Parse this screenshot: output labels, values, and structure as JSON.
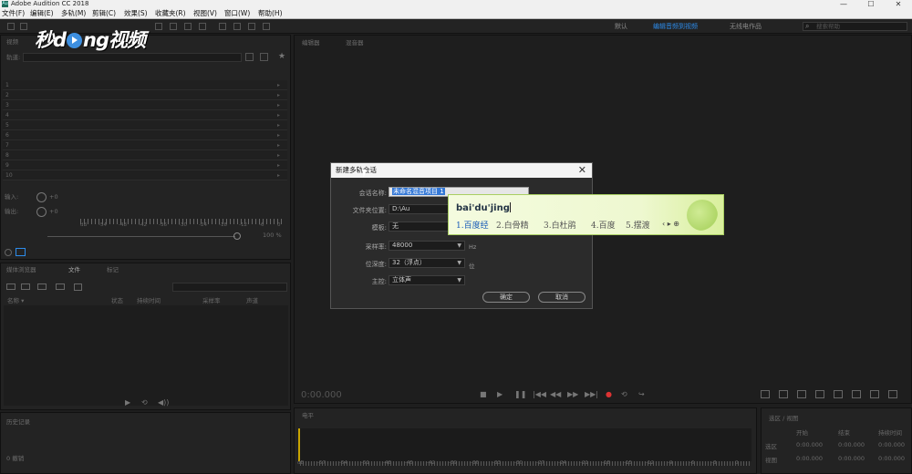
{
  "window": {
    "title": "Adobe Audition CC 2018",
    "icon_text": "Au",
    "controls": [
      "—",
      "☐",
      "✕"
    ]
  },
  "menu": [
    "文件(F)",
    "编辑(E)",
    "多轨(M)",
    "剪辑(C)",
    "效果(S)",
    "收藏夹(R)",
    "视图(V)",
    "窗口(W)",
    "帮助(H)"
  ],
  "workspaces": [
    "默认",
    "编辑音频到视频",
    "无线电作品"
  ],
  "active_workspace": "编辑音频到视频",
  "search": {
    "placeholder": "搜索帮助",
    "icon": "search-icon"
  },
  "logo": {
    "part1": "秒",
    "part2": "d",
    "part3": "ng视频"
  },
  "left_panel": {
    "tab": "视频",
    "track_label": "轨道:",
    "track_numbers": [
      "1",
      "2",
      "3",
      "4",
      "5",
      "6",
      "7",
      "8",
      "9",
      "10"
    ],
    "input_label": "输入:",
    "output_label": "输出:",
    "gain_in": "+0",
    "gain_out": "+0",
    "meter_scale": [
      "dB",
      "-54",
      "-48",
      "-42",
      "-36",
      "-30",
      "-24",
      "-18",
      "-12",
      "-6",
      "0"
    ],
    "zoom_percent": "100 %"
  },
  "files_panel": {
    "tabs": [
      "媒体浏览器",
      "文件",
      "标记"
    ],
    "active_tab": "文件",
    "columns": [
      "名称 ▾",
      "状态",
      "持续时间",
      "采样率",
      "声道"
    ]
  },
  "history_panel": {
    "tab": "历史记录",
    "footer": "0 撤销"
  },
  "editor": {
    "tabs": [
      "编辑器",
      "混音器"
    ],
    "time": "0:00.000"
  },
  "dialog": {
    "title": "新建多轨会话",
    "close": "✕",
    "fields": {
      "session_name_label": "会话名称:",
      "session_name_value": "未命名混音项目 1",
      "folder_label": "文件夹位置:",
      "folder_value": "D:\\Au",
      "template_label": "模板:",
      "template_value": "无",
      "sample_rate_label": "采样率:",
      "sample_rate_value": "48000",
      "sample_rate_unit": "Hz",
      "bit_depth_label": "位深度:",
      "bit_depth_value": "32（浮点）",
      "bit_depth_unit": "位",
      "master_label": "主控:",
      "master_value": "立体声"
    },
    "ok": "确定",
    "cancel": "取消"
  },
  "ime": {
    "pinyin": "bai'du'jing",
    "candidates": [
      "1.百度经",
      "2.白骨精",
      "3.白杜鹃",
      "4.百度",
      "5.摆渡"
    ],
    "nav": "‹ ▸ ⊕"
  },
  "bottom_meter": {
    "tab": "电平",
    "scale": [
      "dB",
      "-57",
      "-54",
      "-51",
      "-48",
      "-45",
      "-42",
      "-39",
      "-36",
      "-33",
      "-30",
      "-27",
      "-24",
      "-21",
      "-18",
      "-15",
      "-12",
      "-9",
      "-6",
      "-3",
      "0"
    ]
  },
  "selection_panel": {
    "tab": "选区 / 视图",
    "headers": [
      "开始",
      "结束",
      "持续时间"
    ],
    "rows": [
      {
        "label": "选区",
        "start": "0:00.000",
        "end": "0:00.000",
        "dur": "0:00.000"
      },
      {
        "label": "视图",
        "start": "0:00.000",
        "end": "0:00.000",
        "dur": "0:00.000"
      }
    ]
  },
  "colors": {
    "accent_blue": "#2d8ceb",
    "panel_bg": "#232323",
    "ime_green": "#eef8d0"
  }
}
